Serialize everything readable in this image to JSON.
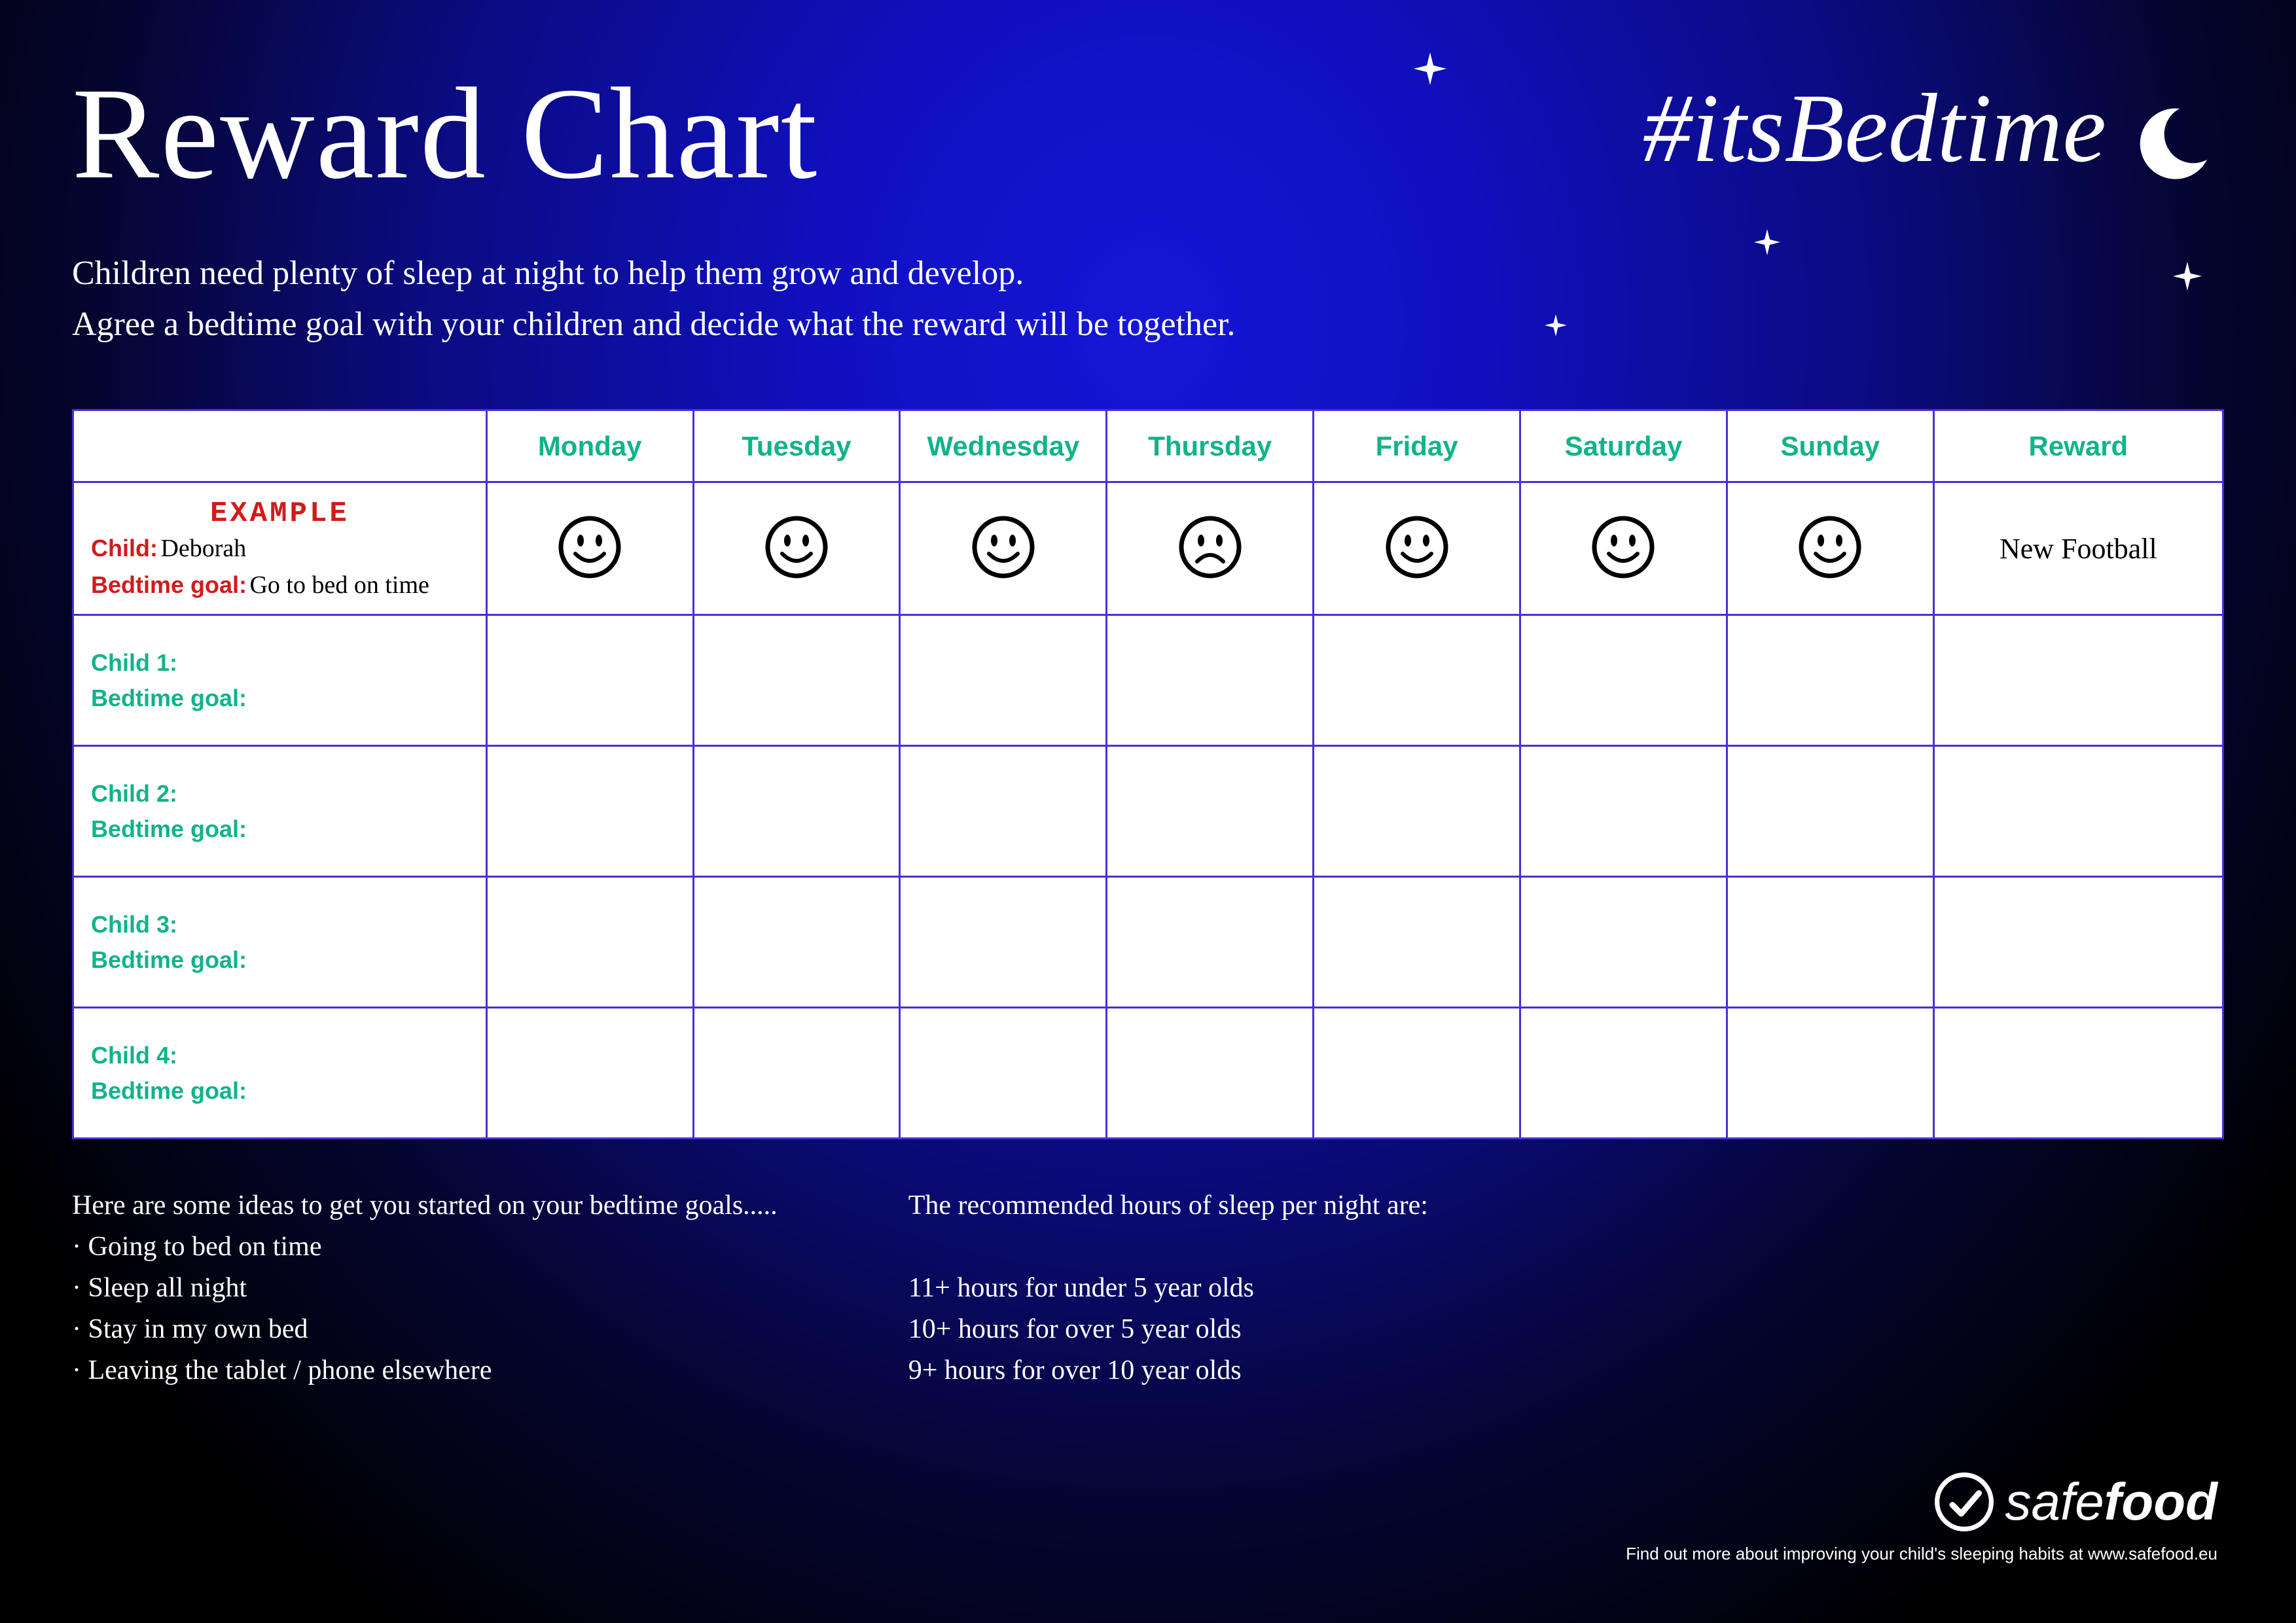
{
  "title": "Reward Chart",
  "hashtag": "#itsBedtime",
  "intro_line1": "Children need plenty of sleep at night to help them grow and develop.",
  "intro_line2": "Agree a bedtime goal with your children and decide what the reward will be together.",
  "days": [
    "Monday",
    "Tuesday",
    "Wednesday",
    "Thursday",
    "Friday",
    "Saturday",
    "Sunday"
  ],
  "reward_header": "Reward",
  "example": {
    "tag": "EXAMPLE",
    "child_label": "Child:",
    "child_name": "Deborah",
    "goal_label": "Bedtime goal:",
    "goal_value": "Go to bed on time",
    "faces": [
      "happy",
      "happy",
      "happy",
      "sad",
      "happy",
      "happy",
      "happy"
    ],
    "reward": "New Football"
  },
  "rows": [
    {
      "child_label": "Child 1:",
      "goal_label": "Bedtime goal:"
    },
    {
      "child_label": "Child 2:",
      "goal_label": "Bedtime goal:"
    },
    {
      "child_label": "Child 3:",
      "goal_label": "Bedtime goal:"
    },
    {
      "child_label": "Child 4:",
      "goal_label": "Bedtime goal:"
    }
  ],
  "ideas": {
    "heading": "Here are some ideas to get you started on your bedtime goals.....",
    "items": [
      "Going to bed on time",
      "Sleep all night",
      "Stay in my own bed",
      "Leaving the tablet / phone elsewhere"
    ]
  },
  "recommended": {
    "heading": "The recommended hours of sleep per night are:",
    "items": [
      "11+ hours for under 5 year olds",
      "10+ hours for over 5 year olds",
      "9+ hours for over 10 year olds"
    ]
  },
  "logo": {
    "brand_light": "safe",
    "brand_bold": "food",
    "tagline": "Find out more about improving your child's sleeping habits at www.safefood.eu"
  }
}
